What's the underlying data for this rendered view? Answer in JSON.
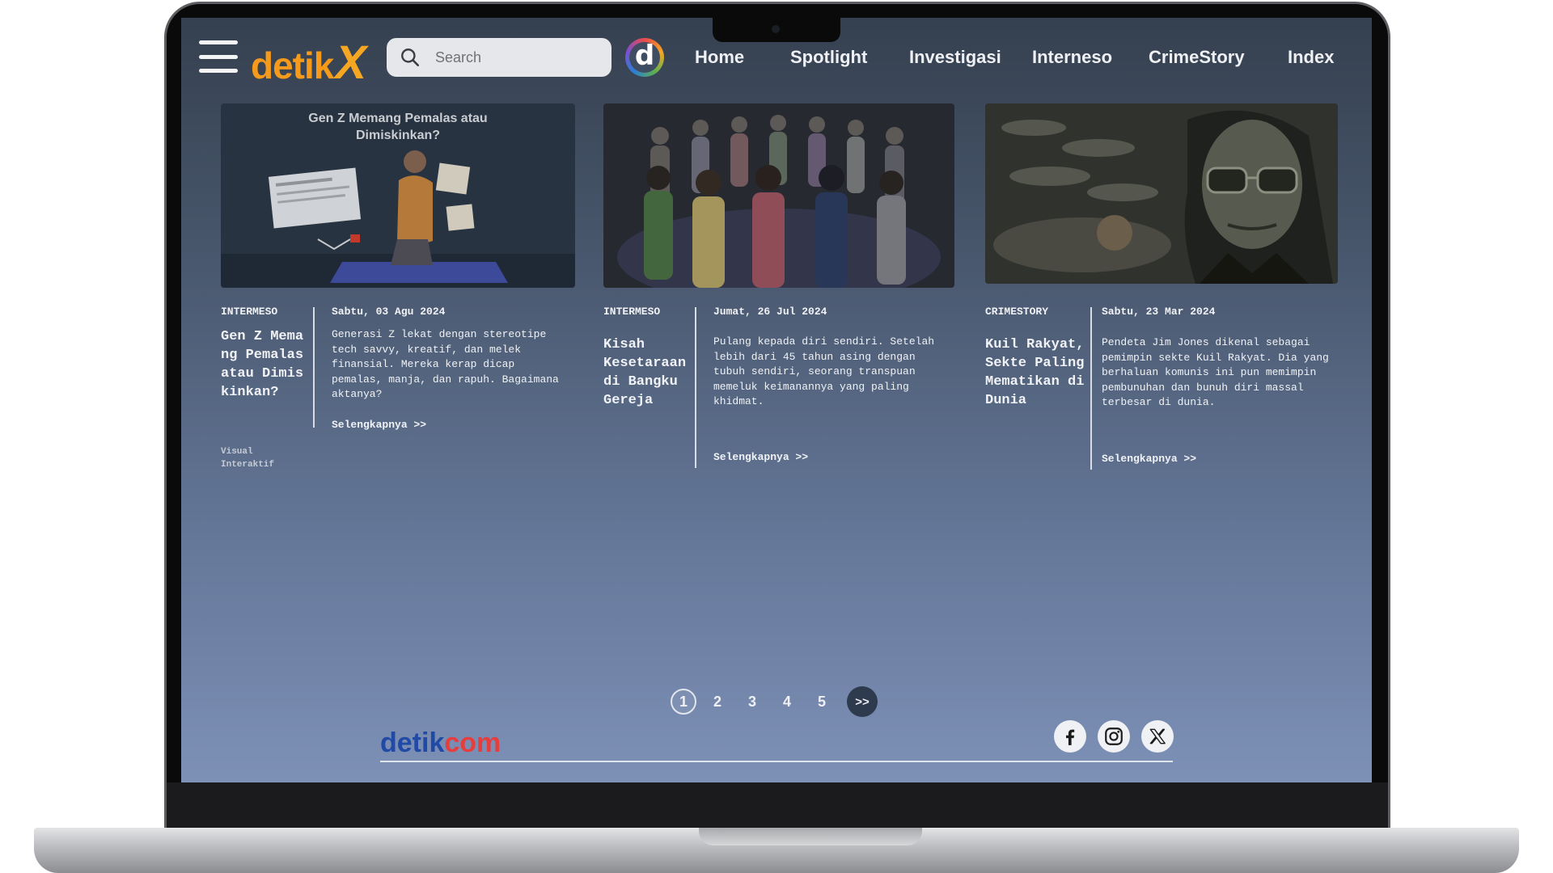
{
  "header": {
    "logo_text": "detik",
    "logo_x": "X",
    "search_placeholder": "Search",
    "detik_app_letter": "d",
    "nav": [
      "Home",
      "Spotlight",
      "Investigasi",
      "Interneso",
      "CrimeStory",
      "Index"
    ]
  },
  "articles": [
    {
      "thumbnail_text": "Gen Z Memang Pemalas atau Dimiskinkan?",
      "category": "INTERMESO",
      "title": "Gen Z Memang Pemalas atau Dimiskinkan?",
      "subtag": "Visual Interaktif",
      "date": "Sabtu, 03 Agu 2024",
      "description": "Generasi Z lekat dengan stereotipe tech savvy, kreatif, dan melek finansial. Mereka kerap dicap pemalas, manja, dan rapuh. Bagaimana aktanya?",
      "more": "Selengkapnya >>"
    },
    {
      "category": "INTERMESO",
      "title": "Kisah Kesetaraan di Bangku Gereja",
      "date": "Jumat, 26 Jul 2024",
      "description": "Pulang kepada diri sendiri. Setelah lebih dari 45 tahun asing dengan tubuh sendiri, seorang transpuan memeluk keimanannya yang paling khidmat.",
      "more": "Selengkapnya >>"
    },
    {
      "category": "CRIMESTORY",
      "title": "Kuil Rakyat, Sekte Paling Mematikan di Dunia",
      "date": "Sabtu, 23 Mar 2024",
      "description": "Pendeta Jim Jones dikenal sebagai pemimpin sekte Kuil Rakyat. Dia yang berhaluan komunis ini pun memimpin pembunuhan dan bunuh diri massal terbesar di dunia.",
      "more": "Selengkapnya >>"
    }
  ],
  "pagination": {
    "pages": [
      "1",
      "2",
      "3",
      "4",
      "5"
    ],
    "current": "1",
    "next": ">>"
  },
  "footer": {
    "logo_part1": "detik",
    "logo_part2": "com",
    "social_icons": [
      "facebook-icon",
      "instagram-icon",
      "x-icon"
    ]
  },
  "colors": {
    "accent": "#f59a1b",
    "background_top": "#35404f",
    "background_bottom": "#7d90b6"
  }
}
